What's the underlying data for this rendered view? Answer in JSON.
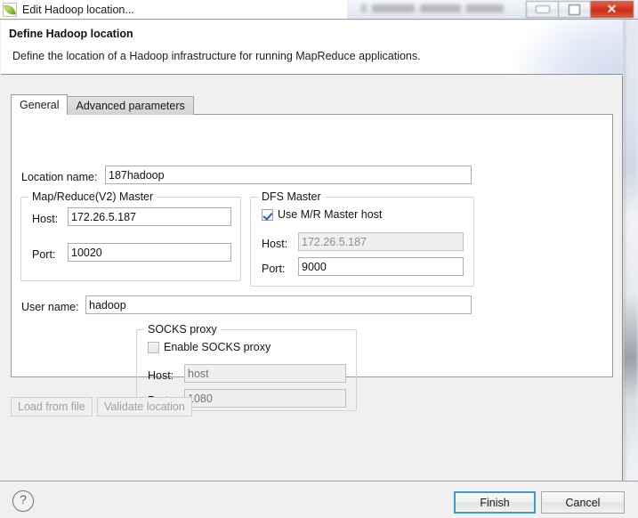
{
  "window": {
    "title": "Edit Hadoop location...",
    "icon": "hadoop-elephant-icon",
    "controls": {
      "minimize": "–",
      "maximize": "□",
      "close": "✕"
    }
  },
  "header": {
    "title": "Define Hadoop location",
    "description": "Define the location of a Hadoop infrastructure for running MapReduce applications."
  },
  "tabs": [
    {
      "label": "General",
      "selected": true
    },
    {
      "label": "Advanced parameters",
      "selected": false
    }
  ],
  "form": {
    "location_name": {
      "label": "Location name:",
      "value": "187hadoop",
      "placeholder": ""
    },
    "mapreduce_master": {
      "group_title": "Map/Reduce(V2) Master",
      "host": {
        "label": "Host:",
        "value": "172.26.5.187"
      },
      "port": {
        "label": "Port:",
        "value": "10020"
      }
    },
    "dfs_master": {
      "group_title": "DFS Master",
      "use_mr_master_host": {
        "label": "Use M/R Master host",
        "checked": true
      },
      "host": {
        "label": "Host:",
        "value": "172.26.5.187",
        "disabled": true
      },
      "port": {
        "label": "Port:",
        "value": "9000",
        "disabled": false
      }
    },
    "user_name": {
      "label": "User name:",
      "value": "hadoop"
    },
    "socks_proxy": {
      "group_title": "SOCKS proxy",
      "enable": {
        "label": "Enable SOCKS proxy",
        "checked": false
      },
      "host": {
        "label": "Host:",
        "value": "",
        "placeholder": "host",
        "disabled": true
      },
      "port": {
        "label": "Port:",
        "value": "",
        "placeholder": "1080",
        "disabled": true
      }
    }
  },
  "actions": {
    "load_from_file": "Load from file",
    "validate_location": "Validate location"
  },
  "footer": {
    "help": "?",
    "finish": "Finish",
    "cancel": "Cancel"
  },
  "colors": {
    "accent_focus": "#3c9ad1",
    "close_button": "#d6341d",
    "checkbox_check": "#2a63b5",
    "panel_background": "#f0f0f0",
    "field_background": "#ffffff",
    "field_disabled": "#efefef"
  }
}
